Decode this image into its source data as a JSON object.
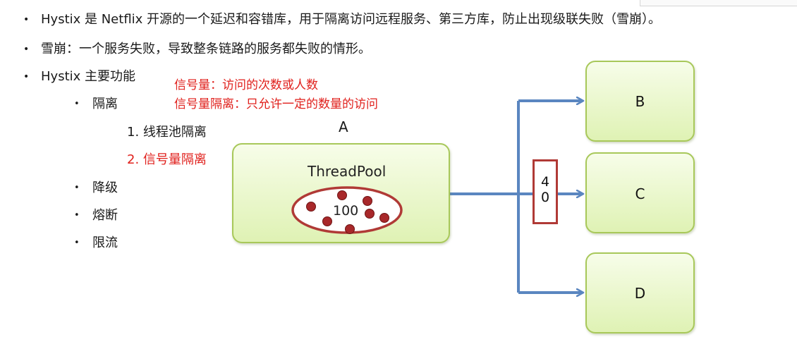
{
  "bullets": [
    "Hystix 是 Netflix 开源的一个延迟和容错库，用于隔离访问远程服务、第三方库，防止出现级联失败（雪崩）。",
    "雪崩：一个服务失败，导致整条链路的服务都失败的情形。",
    "Hystix 主要功能"
  ],
  "features": [
    "隔离",
    "降级",
    "熔断",
    "限流"
  ],
  "isolation_types": [
    "1. 线程池隔离",
    "2. 信号量隔离"
  ],
  "notes": {
    "semaphore_def": "信号量：访问的次数或人数",
    "semaphore_isolation_def": "信号量隔离：只允许一定的数量的访问"
  },
  "diagram": {
    "service_a": "A",
    "pool_title": "ThreadPool",
    "pool_count": "100",
    "semaphore_digits": [
      "4",
      "0"
    ],
    "targets": [
      "B",
      "C",
      "D"
    ],
    "colors": {
      "box_border": "#a8c85a",
      "arrow": "#5a86c0",
      "pool_ellipse": "#b03a36",
      "thread_dot": "#a8282a",
      "emphasis_text": "#e0201c"
    }
  }
}
